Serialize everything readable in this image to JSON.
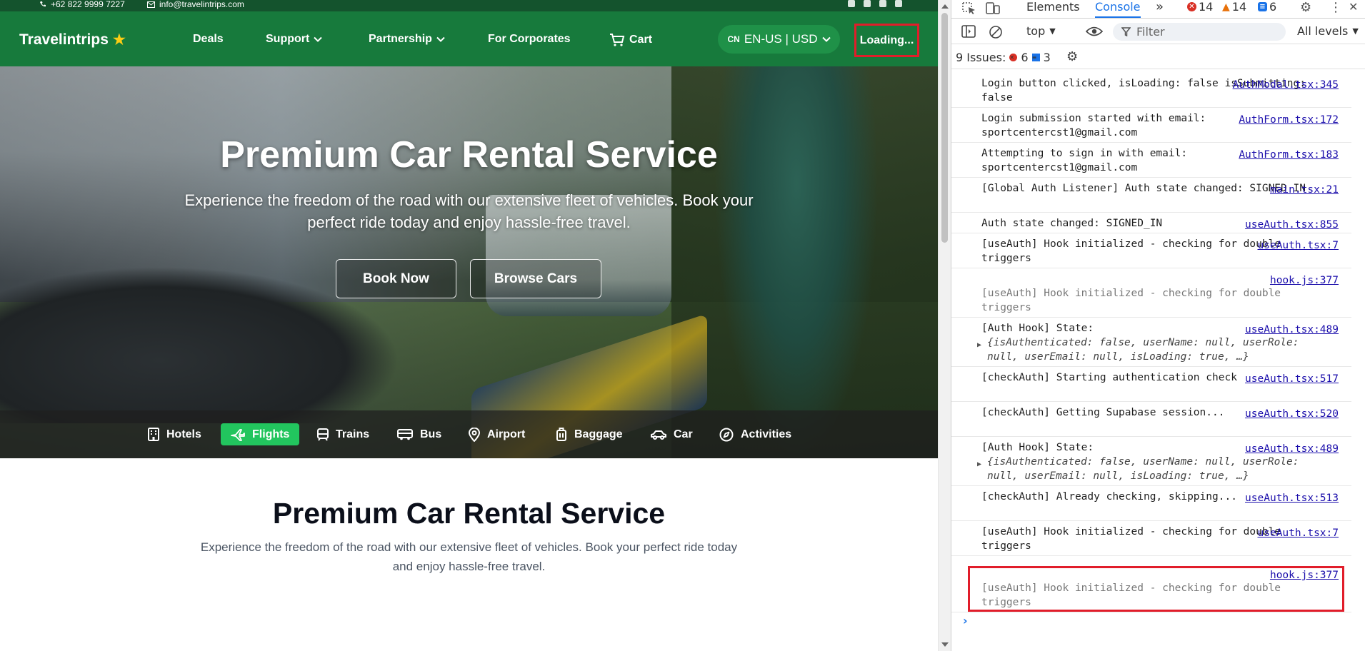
{
  "topbar": {
    "phone": "+62 822 9999 7227",
    "email": "info@travelintrips.com"
  },
  "nav": {
    "brand": "Travelintrips",
    "items": [
      "Deals",
      "Support",
      "Partnership",
      "For Corporates",
      "Cart"
    ],
    "lang_prefix": "CN",
    "lang_label": "EN-US | USD",
    "loading": "Loading..."
  },
  "hero": {
    "title": "Premium Car Rental Service",
    "subtitle": "Experience the freedom of the road with our extensive fleet of vehicles. Book your perfect ride today and enjoy hassle-free travel.",
    "btn_book": "Book Now",
    "btn_browse": "Browse Cars"
  },
  "categories": [
    "Hotels",
    "Flights",
    "Trains",
    "Bus",
    "Airport",
    "Baggage",
    "Car",
    "Activities"
  ],
  "active_category": "Flights",
  "section": {
    "title": "Premium Car Rental Service",
    "subtitle": "Experience the freedom of the road with our extensive fleet of vehicles. Book your perfect ride today and enjoy hassle-free travel."
  },
  "devtools": {
    "tabs": [
      "Elements",
      "Console"
    ],
    "active_tab": "Console",
    "errors": "14",
    "warnings": "14",
    "infos": "6",
    "context": "top",
    "filter_placeholder": "Filter",
    "levels": "All levels",
    "issues_label": "9 Issues:",
    "issues_errors": "6",
    "issues_infos": "3",
    "logs": [
      {
        "text": "Login button clicked, isLoading: false isSubmitting: false",
        "src": "AuthModal.tsx:345"
      },
      {
        "text": "Login submission started with email: sportcentercst1@gmail.com",
        "src": "AuthForm.tsx:172"
      },
      {
        "text": "Attempting to sign in with email: sportcentercst1@gmail.com",
        "src": "AuthForm.tsx:183"
      },
      {
        "text": "[Global Auth Listener] Auth state changed: SIGNED_IN",
        "src": "main.tsx:21"
      },
      {
        "text": "Auth state changed: SIGNED_IN",
        "src": "useAuth.tsx:855"
      },
      {
        "text": "[useAuth] Hook initialized - checking for double triggers",
        "src": "useAuth.tsx:7"
      },
      {
        "text": "[useAuth] Hook initialized - checking for double triggers",
        "src": "hook.js:377"
      },
      {
        "text": "[Auth Hook] State:",
        "src": "useAuth.tsx:489",
        "obj": "{isAuthenticated: false, userName: null, userRole: null, userEmail: null, isLoading: true, …}"
      },
      {
        "text": "[checkAuth] Starting authentication check",
        "src": "useAuth.tsx:517"
      },
      {
        "text": "[checkAuth] Getting Supabase session...",
        "src": "useAuth.tsx:520"
      },
      {
        "text": "[Auth Hook] State:",
        "src": "useAuth.tsx:489",
        "obj": "{isAuthenticated: false, userName: null, userRole: null, userEmail: null, isLoading: true, …}"
      },
      {
        "text": "[checkAuth] Already checking, skipping...",
        "src": "useAuth.tsx:513"
      },
      {
        "text": "[useAuth] Hook initialized - checking for double triggers",
        "src": "useAuth.tsx:7"
      },
      {
        "text": "[useAuth] Hook initialized - checking for double triggers",
        "src": "hook.js:377"
      }
    ]
  },
  "colors": {
    "nav_green": "#177a3c",
    "active_green": "#22c55e",
    "highlight_red": "#e11d2a",
    "devtools_blue": "#1a73e8"
  }
}
